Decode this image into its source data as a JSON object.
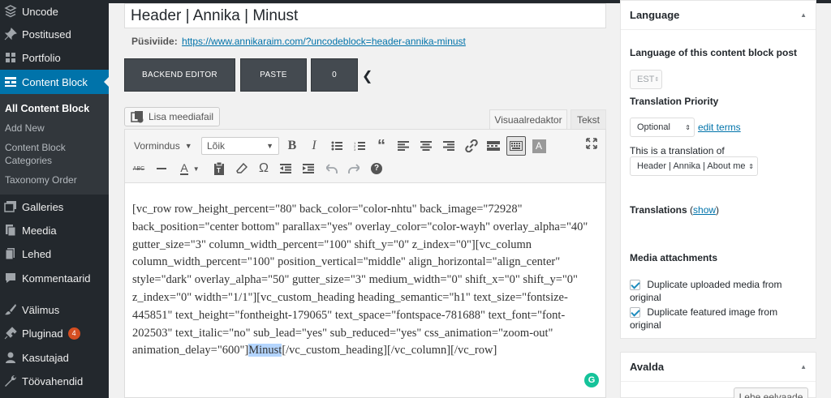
{
  "sidebar": {
    "items": [
      {
        "label": "Uncode",
        "icon": "uncode-icon"
      },
      {
        "label": "Postitused",
        "icon": "pin-icon"
      },
      {
        "label": "Portfolio",
        "icon": "portfolio-icon"
      },
      {
        "label": "Content Block",
        "icon": "content-block-icon"
      },
      {
        "label": "Galleries",
        "icon": "galleries-icon"
      },
      {
        "label": "Meedia",
        "icon": "media-icon"
      },
      {
        "label": "Lehed",
        "icon": "pages-icon"
      },
      {
        "label": "Kommentaarid",
        "icon": "comments-icon"
      },
      {
        "label": "Välimus",
        "icon": "appearance-icon"
      },
      {
        "label": "Pluginad",
        "icon": "plugins-icon",
        "badge": "4"
      },
      {
        "label": "Kasutajad",
        "icon": "users-icon"
      },
      {
        "label": "Töövahendid",
        "icon": "tools-icon"
      }
    ],
    "submenu": [
      "All Content Block",
      "Add New",
      "Content Block Categories",
      "Taxonomy Order"
    ]
  },
  "post": {
    "title": "Header | Annika | Minust",
    "permalink_label": "Püsiviide:",
    "permalink_url": "https://www.annikaraim.com/?uncodeblock=header-annika-minust"
  },
  "builder": {
    "backend_editor": "BACKEND EDITOR",
    "paste": "PASTE",
    "count": "0"
  },
  "editor": {
    "add_media": "Lisa meediafail",
    "tab_visual": "Visuaalredaktor",
    "tab_text": "Tekst",
    "format_select": "Vormindus",
    "font_select": "Lõik",
    "content_before": "[vc_row row_height_percent=\"80\" back_color=\"color-nhtu\" back_image=\"72928\" back_position=\"center bottom\" parallax=\"yes\" overlay_color=\"color-wayh\" overlay_alpha=\"40\" gutter_size=\"3\" column_width_percent=\"100\" shift_y=\"0\" z_index=\"0\"][vc_column column_width_percent=\"100\" position_vertical=\"middle\" align_horizontal=\"align_center\" style=\"dark\" overlay_alpha=\"50\" gutter_size=\"3\" medium_width=\"0\" shift_x=\"0\" shift_y=\"0\" z_index=\"0\" width=\"1/1\"][vc_custom_heading heading_semantic=\"h1\" text_size=\"fontsize-445851\" text_height=\"fontheight-179065\" text_space=\"fontspace-781688\" text_font=\"font-202503\" text_italic=\"no\" sub_lead=\"yes\" sub_reduced=\"yes\" css_animation=\"zoom-out\" animation_delay=\"600\"]",
    "content_highlight": "Minust",
    "content_after": "[/vc_custom_heading][/vc_column][/vc_row]"
  },
  "language_panel": {
    "title": "Language",
    "lang_label": "Language of this content block post",
    "lang_value": "EST",
    "priority_label": "Translation Priority",
    "priority_value": "Optional",
    "edit_terms": "edit terms",
    "translation_of_label": "This is a translation of",
    "translation_of_value": "Header | Annika | About me",
    "translations_label": "Translations",
    "translations_show": "show",
    "media_label": "Media attachments",
    "dup_media": "Duplicate uploaded media from original",
    "dup_featured": "Duplicate featured image from original"
  },
  "publish_panel": {
    "title": "Avalda",
    "preview": "Lehe eelvaade"
  }
}
